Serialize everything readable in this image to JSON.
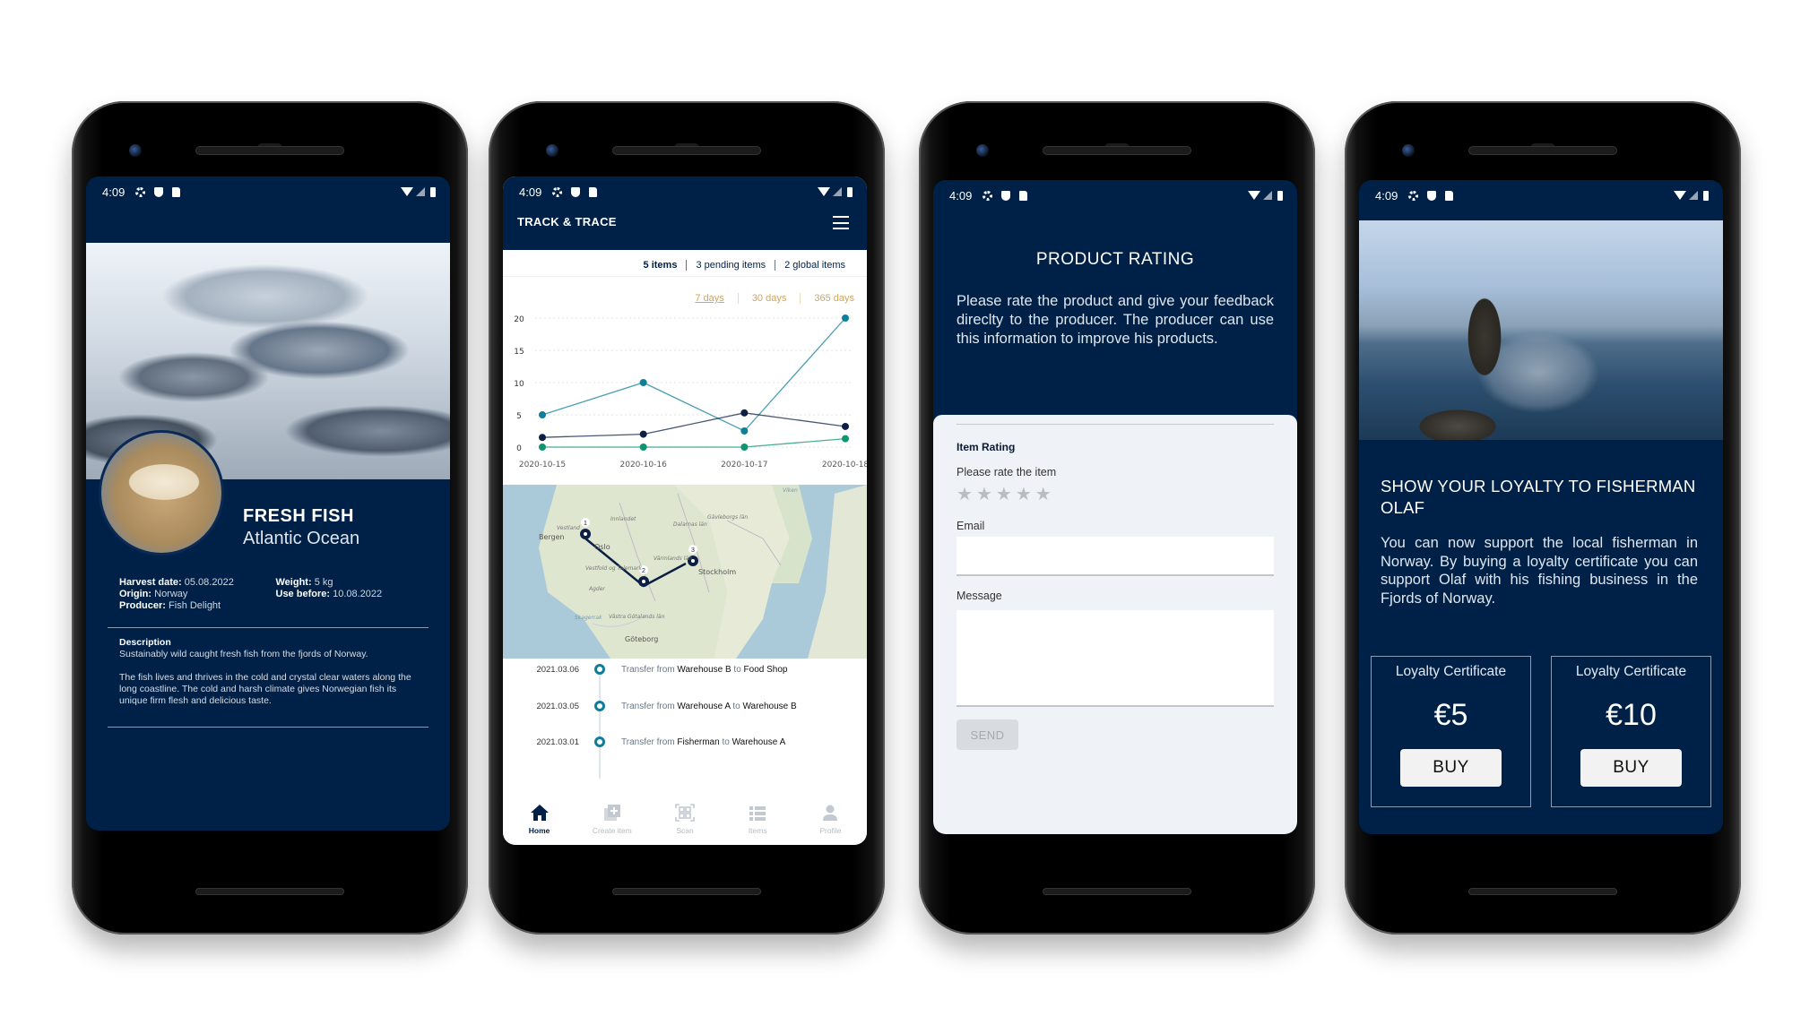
{
  "status_bar": {
    "time": "4:09"
  },
  "phones": {
    "product": {
      "title": "FRESH FISH",
      "subtitle": "Atlantic Ocean",
      "meta_left": [
        {
          "label": "Harvest date:",
          "value": "05.08.2022"
        },
        {
          "label": "Origin:",
          "value": "Norway"
        },
        {
          "label": "Producer:",
          "value": "Fish Delight"
        }
      ],
      "meta_right": [
        {
          "label": "Weight:",
          "value": "5 kg"
        },
        {
          "label": "Use before:",
          "value": "10.08.2022"
        }
      ],
      "description_heading": "Description",
      "description_lines": [
        "Sustainably wild caught fresh fish from the fjords of Norway.",
        "The fish lives and thrives in the cold and crystal clear waters along the long coastline. The cold and harsh climate gives Norwegian fish its unique firm flesh and delicious taste."
      ]
    },
    "track": {
      "app_title": "TRACK & TRACE",
      "counts": [
        "5 items",
        "3 pending items",
        "2 global items"
      ],
      "ranges": [
        "7 days",
        "30 days",
        "365 days"
      ],
      "active_range": "7 days",
      "map_labels": {
        "bergen": "Bergen",
        "oslo": "Oslo",
        "stockholm": "Stockholm",
        "goteborg": "Göteborg",
        "innlandet": "Innlandet",
        "vestland": "Vestland",
        "dalarnas": "Dalarnas län",
        "gavleborgs": "Gävleborgs län",
        "varmlands": "Värmlands län",
        "vestfold": "Vestfold og Telemark",
        "agder": "Agder",
        "vastra": "Västra Götalands län",
        "skagerrak": "Skagerrak",
        "viken": "Viken"
      },
      "map_pins": [
        "1",
        "2",
        "3"
      ],
      "timeline": [
        {
          "date": "2021.03.06",
          "prefix": "Transfer from",
          "from": "Warehouse B",
          "mid": "to",
          "to": "Food Shop"
        },
        {
          "date": "2021.03.05",
          "prefix": "Transfer from",
          "from": "Warehouse A",
          "mid": "to",
          "to": "Warehouse B"
        },
        {
          "date": "2021.03.01",
          "prefix": "Transfer from",
          "from": "Fisherman",
          "mid": "to",
          "to": "Warehouse A"
        }
      ],
      "nav": [
        {
          "label": "Home",
          "icon": "home-icon",
          "active": true
        },
        {
          "label": "Create item",
          "icon": "add-box-icon",
          "active": false
        },
        {
          "label": "Scan",
          "icon": "qr-scan-icon",
          "active": false
        },
        {
          "label": "Items",
          "icon": "list-icon",
          "active": false
        },
        {
          "label": "Profile",
          "icon": "person-icon",
          "active": false
        }
      ]
    },
    "rating": {
      "heading": "PRODUCT RATING",
      "intro": "Please rate the product and give your feedback direclty to the producer. The producer can use this information to improve his products.",
      "section_label": "Item Rating",
      "rate_prompt": "Please rate the item",
      "stars_total": 5,
      "stars_selected": 0,
      "email_label": "Email",
      "email_value": "",
      "message_label": "Message",
      "message_value": "",
      "send_label": "SEND"
    },
    "loyalty": {
      "heading": "SHOW YOUR LOYALTY TO FISHERMAN OLAF",
      "paragraph": "You can now support the local fisherman in Norway. By buying a loyalty certificate you can support Olaf with his fishing business in the  Fjords of Norway.",
      "certificates": [
        {
          "title": "Loyalty Certificate",
          "price": "€5",
          "button": "BUY"
        },
        {
          "title": "Loyalty Certificate",
          "price": "€10",
          "button": "BUY"
        }
      ]
    }
  },
  "colors": {
    "brand_navy": "#002147",
    "teal": "#0e7f9a",
    "green": "#0f9470",
    "gold": "#d0a55c",
    "route": "#0b1f45"
  },
  "chart_data": {
    "type": "line",
    "title": "",
    "xlabel": "",
    "ylabel": "",
    "x": [
      "2020-10-15",
      "2020-10-16",
      "2020-10-17",
      "2020-10-18"
    ],
    "yticks": [
      0,
      5,
      10,
      15,
      20
    ],
    "ylim": [
      0,
      20
    ],
    "grid": true,
    "series": [
      {
        "name": "items",
        "color": "#0e7f9a",
        "values": [
          5,
          10,
          2.5,
          20
        ]
      },
      {
        "name": "pending items",
        "color": "#0b1f45",
        "values": [
          1.5,
          2,
          5.3,
          3.2
        ]
      },
      {
        "name": "global items",
        "color": "#0f9470",
        "values": [
          0,
          0,
          0,
          1.3
        ]
      }
    ]
  }
}
